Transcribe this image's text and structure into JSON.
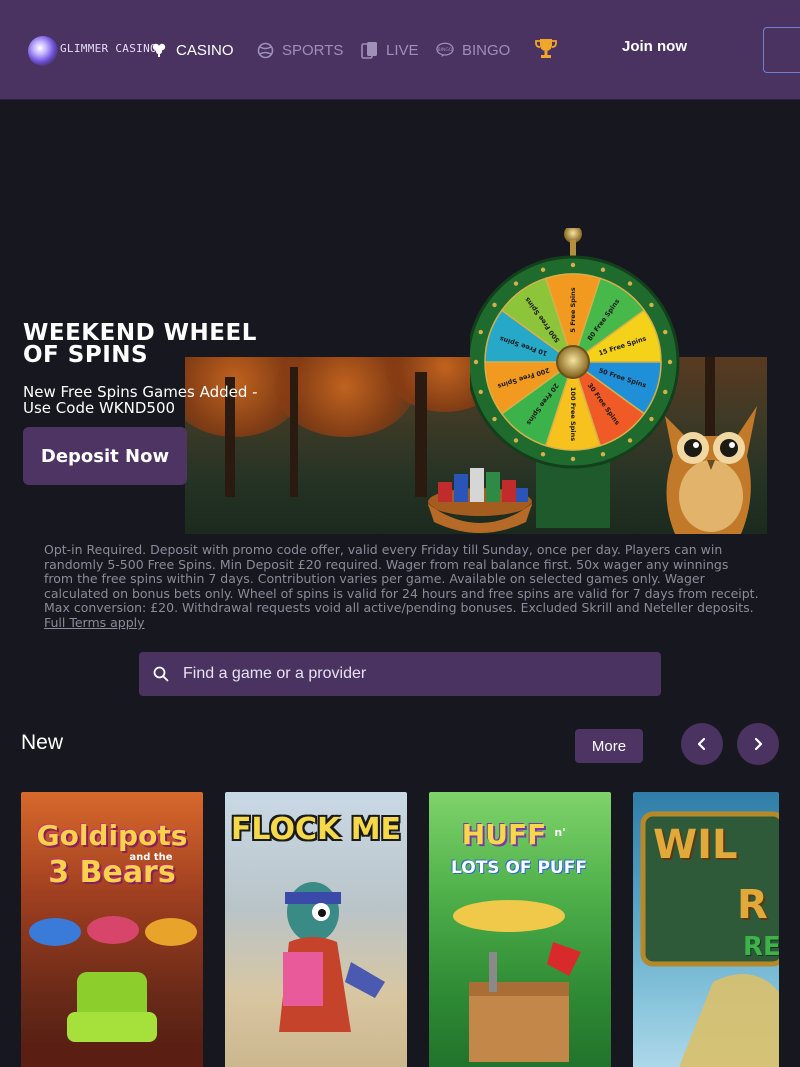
{
  "brand": {
    "name": "GLIMMER CASINO"
  },
  "nav": {
    "items": [
      {
        "label": "CASINO",
        "icon": "cards-icon",
        "active": true
      },
      {
        "label": "SPORTS",
        "icon": "ball-icon"
      },
      {
        "label": "LIVE",
        "icon": "live-cards-icon"
      },
      {
        "label": "BINGO",
        "icon": "bingo-icon"
      }
    ],
    "trophy_icon": "trophy-icon",
    "join_label": "Join now"
  },
  "hero": {
    "title": "WEEKEND WHEEL OF SPINS",
    "subtitle": "New Free Spins Games Added - Use Code WKND500",
    "cta_label": "Deposit Now",
    "wheel_labels": [
      "5 Free Spins",
      "80 Free Spins",
      "15 Free Spins",
      "50 Free Spins",
      "30 Free Spins",
      "100 Free Spins",
      "20 Free Spins",
      "200 Free Spins",
      "10 Free Spins",
      "500 Free Spins"
    ]
  },
  "terms": {
    "text": "Opt-in Required. Deposit with promo code offer, valid every Friday till Sunday, once per day. Players can win randomly 5-500 Free Spins. Min Deposit £20 required. Wager from real balance first. 50x wager any winnings from the free spins within 7 days. Contribution varies per game. Available on selected games only. Wager calculated on bonus bets only. Wheel of spins is valid for 24 hours and free spins are valid for 7 days from receipt. Max conversion: £20. Withdrawal requests void all active/pending bonuses. Excluded Skrill and Neteller deposits.",
    "link_label": "Full Terms apply"
  },
  "search": {
    "placeholder": "Find a game or a provider"
  },
  "section": {
    "title": "New",
    "more_label": "More"
  },
  "games": [
    {
      "title_line1": "Goldipots",
      "title_small": "and the",
      "title_line2": "3 Bears"
    },
    {
      "title": "FLOCK ME"
    },
    {
      "title_line1": "HUFF",
      "title_small": "n'",
      "title_line2": "LOTS OF PUFF"
    },
    {
      "title_line1": "WIL",
      "title_line2": "R",
      "title_line3": "RE"
    }
  ],
  "colors": {
    "header_bg": "#4a3361",
    "page_bg": "#17171f",
    "button_bg": "#4e3463",
    "accent_trophy": "#f0a62a"
  }
}
